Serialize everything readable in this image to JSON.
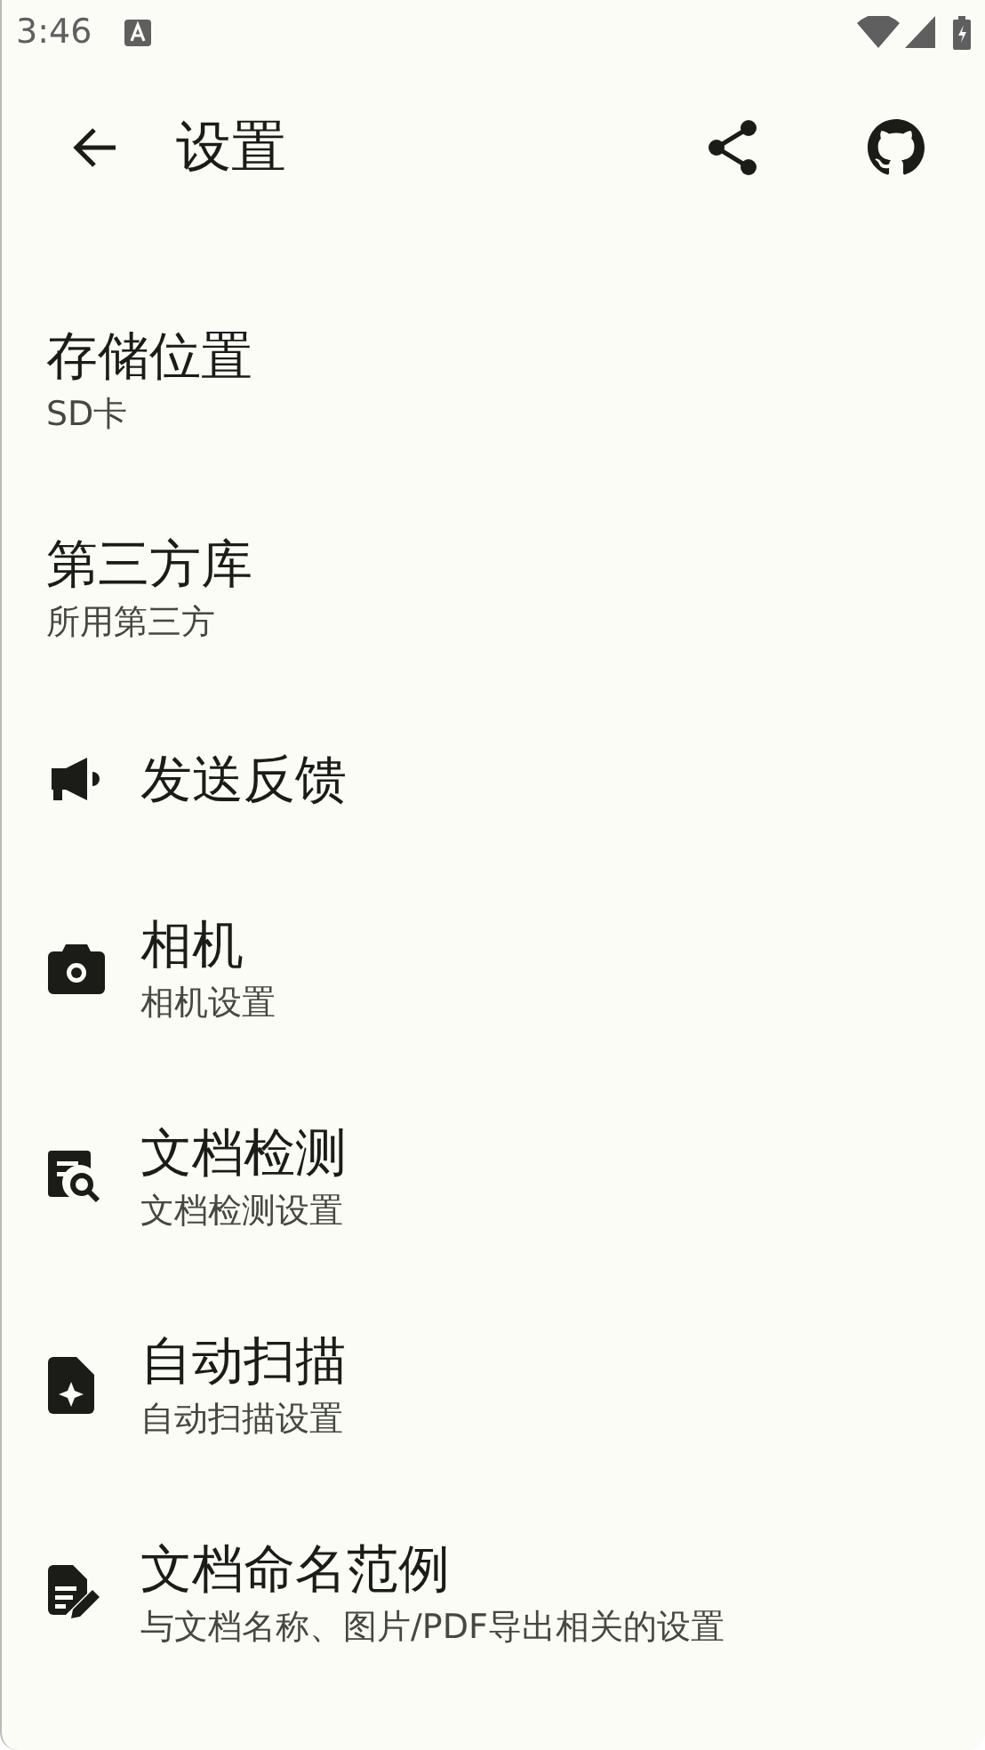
{
  "status_bar": {
    "time": "3:46"
  },
  "app_bar": {
    "title": "设置"
  },
  "items": [
    {
      "kind": "plain",
      "title": "存储位置",
      "subtitle": "SD卡"
    },
    {
      "kind": "plain",
      "title": "第三方库",
      "subtitle": "所用第三方"
    },
    {
      "kind": "icon",
      "title": "发送反馈"
    },
    {
      "kind": "icon",
      "title": "相机",
      "subtitle": "相机设置"
    },
    {
      "kind": "icon",
      "title": "文档检测",
      "subtitle": "文档检测设置"
    },
    {
      "kind": "icon",
      "title": "自动扫描",
      "subtitle": "自动扫描设置"
    },
    {
      "kind": "icon",
      "title": "文档命名范例",
      "subtitle": "与文档名称、图片/PDF导出相关的设置"
    }
  ]
}
